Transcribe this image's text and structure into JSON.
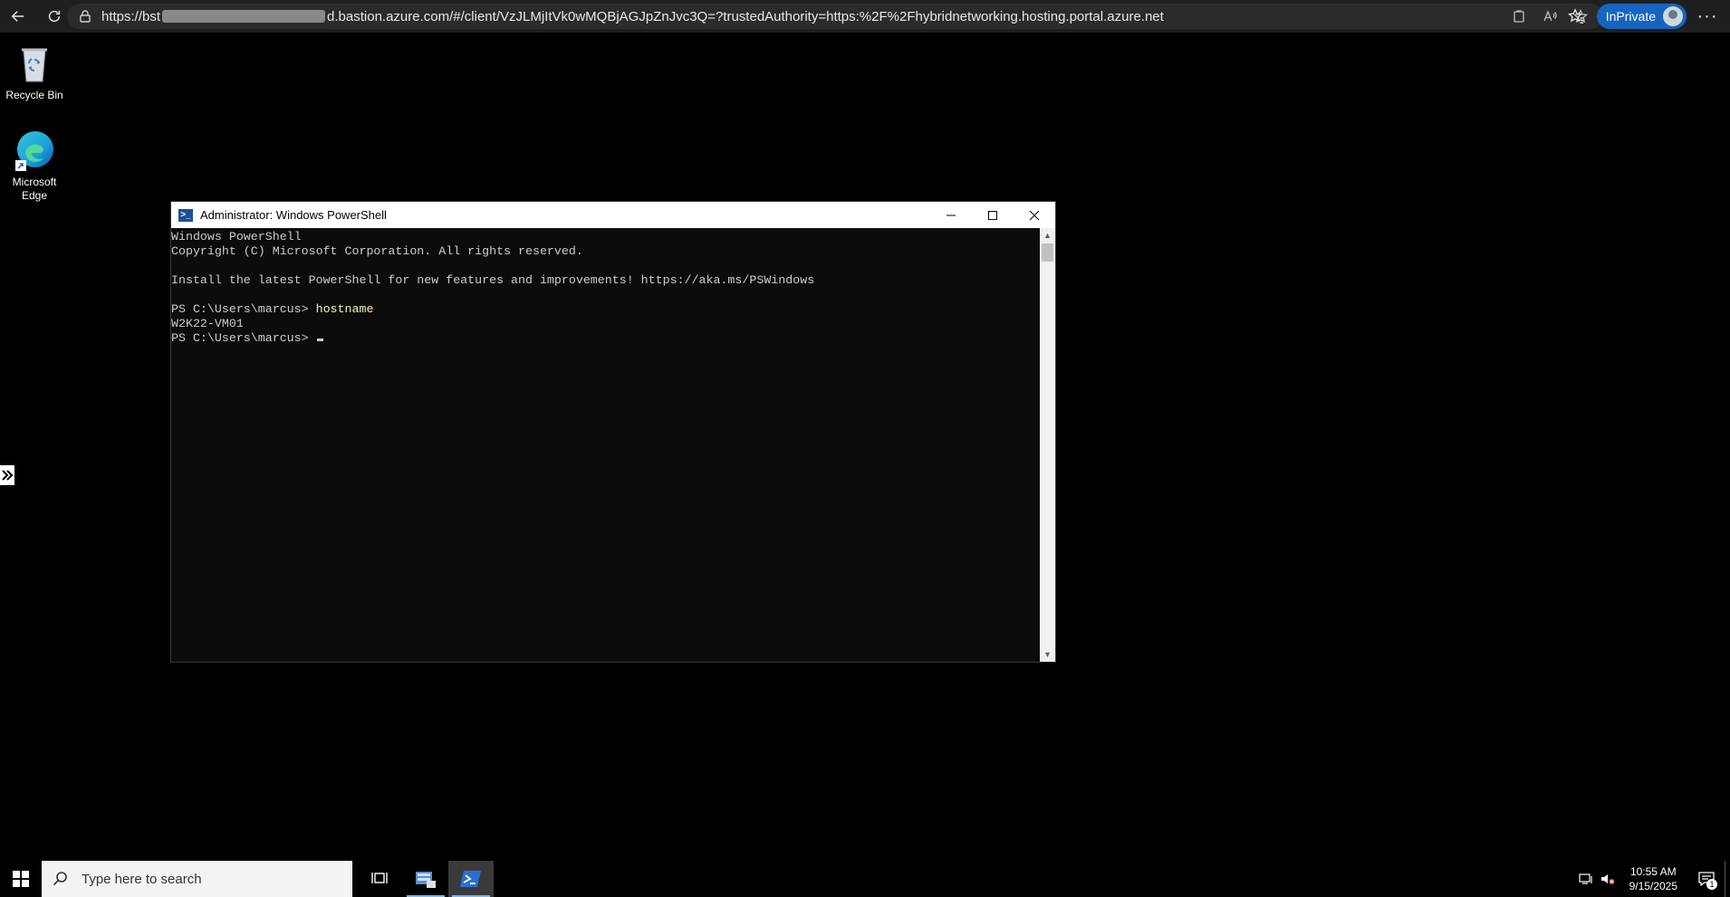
{
  "browser": {
    "url_prefix": "https://bst",
    "url_suffix": "d.bastion.azure.com/#/client/VzJLMjItVk0wMQBjAGJpZnJvc3Q=?trustedAuthority=https:%2F%2Fhybridnetworking.hosting.portal.azure.net",
    "inprivate_label": "InPrivate",
    "more_label": "···"
  },
  "desktop": {
    "icons": [
      {
        "label": "Recycle Bin"
      },
      {
        "label": "Microsoft\nEdge"
      }
    ]
  },
  "powershell": {
    "title": "Administrator: Windows PowerShell",
    "lines": [
      {
        "text": "Windows PowerShell"
      },
      {
        "text": "Copyright (C) Microsoft Corporation. All rights reserved."
      },
      {
        "text": ""
      },
      {
        "text": "Install the latest PowerShell for new features and improvements! https://aka.ms/PSWindows"
      },
      {
        "text": ""
      },
      {
        "prompt": "PS C:\\Users\\marcus> ",
        "command": "hostname"
      },
      {
        "text": "W2K22-VM01"
      },
      {
        "prompt": "PS C:\\Users\\marcus>"
      }
    ]
  },
  "taskbar": {
    "search_placeholder": "Type here to search",
    "time": "10:55 AM",
    "date": "9/15/2025",
    "notification_count": "1"
  },
  "colors": {
    "accent": "#1565c0",
    "command_text": "#f9f1a5",
    "console_bg": "#0c0c0c",
    "taskbar_active_underline": "#76b9ed"
  }
}
